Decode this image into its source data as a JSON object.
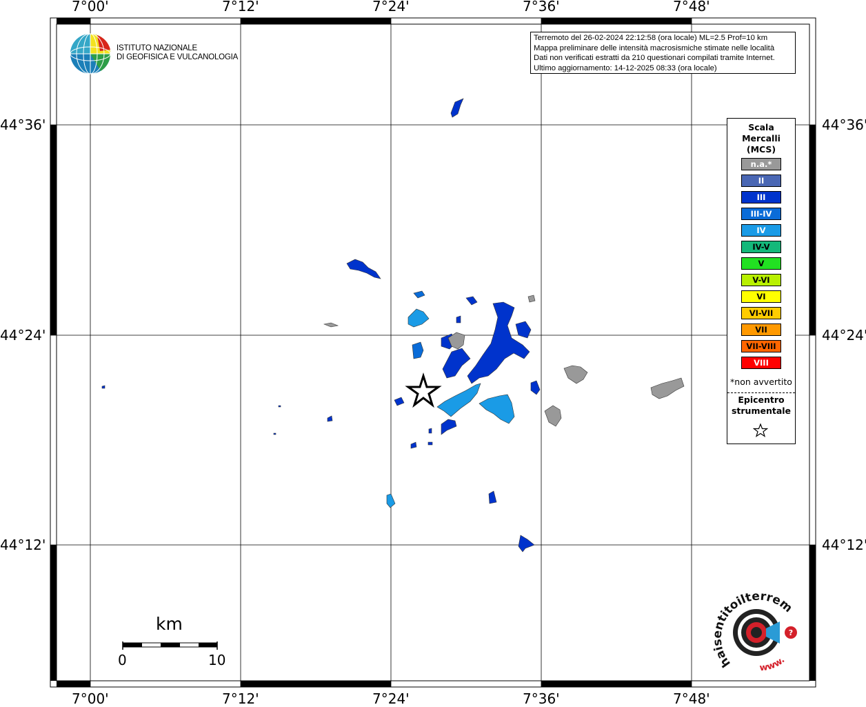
{
  "map": {
    "lon_ticks": [
      "7°00'",
      "7°12'",
      "7°24'",
      "7°36'",
      "7°48'"
    ],
    "lat_ticks": [
      "44°36'",
      "44°24'",
      "44°12'"
    ]
  },
  "logo": {
    "line1": "ISTITUTO NAZIONALE",
    "line2": "DI GEOFISICA E VULCANOLOGIA"
  },
  "info": {
    "line1": "Terremoto del 26-02-2024 22:12:58 (ora locale) ML=2.5 Prof=10 km",
    "line2": "Mappa preliminare delle intensità macrosismiche stimate nelle località",
    "line3": "Dati non verificati estratti da 210 questionari compilati tramite Internet.",
    "line4": "Ultimo aggiornamento: 14-12-2025 08:33 (ora locale)"
  },
  "legend": {
    "title_line1": "Scala",
    "title_line2": "Mercalli",
    "title_line3": "(MCS)",
    "items": [
      {
        "label": "n.a.*",
        "color": "#999999",
        "text_color": "#ffffff"
      },
      {
        "label": "II",
        "color": "#4a67b4",
        "text_color": "#ffffff"
      },
      {
        "label": "III",
        "color": "#0033cc",
        "text_color": "#ffffff"
      },
      {
        "label": "III-IV",
        "color": "#0a6cd8",
        "text_color": "#ffffff"
      },
      {
        "label": "IV",
        "color": "#1a9be6",
        "text_color": "#ffffff"
      },
      {
        "label": "IV-V",
        "color": "#14b87a",
        "text_color": "#000000"
      },
      {
        "label": "V",
        "color": "#22e022",
        "text_color": "#000000"
      },
      {
        "label": "V-VI",
        "color": "#b8f000",
        "text_color": "#000000"
      },
      {
        "label": "VI",
        "color": "#ffff00",
        "text_color": "#000000"
      },
      {
        "label": "VI-VII",
        "color": "#ffcc00",
        "text_color": "#000000"
      },
      {
        "label": "VII",
        "color": "#ff9900",
        "text_color": "#000000"
      },
      {
        "label": "VII-VIII",
        "color": "#ff6600",
        "text_color": "#000000"
      },
      {
        "label": "VIII",
        "color": "#ff0000",
        "text_color": "#ffffff"
      }
    ],
    "note": "*non avvertito",
    "epicenter_line1": "Epicentro",
    "epicenter_line2": "strumentale",
    "epicenter_icon": "star-icon"
  },
  "scale_bar": {
    "unit": "km",
    "start": "0",
    "end": "10"
  },
  "haisentito": {
    "text": "haisentitoilterremoto.it",
    "url_prefix": "www."
  }
}
